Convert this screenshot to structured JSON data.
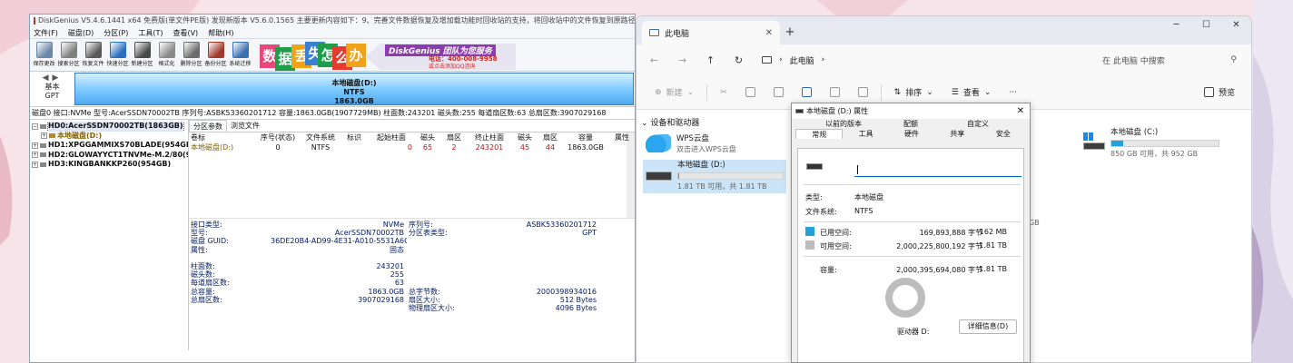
{
  "diskgenius": {
    "title": "DiskGenius V5.4.6.1441 x64 免费版(单文件PE版)  发现新版本 V5.6.0.1565  主要更新内容如下：9、完善文件数据恢复及增加载功能时回收站的支持，将回收站中的文件恢复到原路径。",
    "menu": [
      "文件(F)",
      "磁盘(D)",
      "分区(P)",
      "工具(T)",
      "查看(V)",
      "帮助(H)"
    ],
    "toolbar": [
      {
        "label": "保存更改",
        "icon": "save-icon",
        "color": "#6a86a8"
      },
      {
        "label": "搜索分区",
        "icon": "search-icon",
        "color": "#7f7f7f"
      },
      {
        "label": "恢复文件",
        "icon": "recover-icon",
        "color": "#5a5a5a"
      },
      {
        "label": "快速分区",
        "icon": "quick-partition-icon",
        "color": "#2a6fbf"
      },
      {
        "label": "新建分区",
        "icon": "new-partition-icon",
        "color": "#4a4a4a"
      },
      {
        "label": "格式化",
        "icon": "format-icon",
        "color": "#8a8a8a"
      },
      {
        "label": "删除分区",
        "icon": "delete-icon",
        "color": "#6b6b6b"
      },
      {
        "label": "备份分区",
        "icon": "backup-icon",
        "color": "#a03a2a"
      },
      {
        "label": "系统迁移",
        "icon": "migrate-icon",
        "color": "#3a6fb0"
      }
    ],
    "ad": {
      "tiles": [
        {
          "ch": "数",
          "color": "#e8487b"
        },
        {
          "ch": "据",
          "color": "#1f9e4a"
        },
        {
          "ch": "丢",
          "color": "#f0a21a"
        },
        {
          "ch": "失",
          "color": "#3a7fd0"
        },
        {
          "ch": "怎",
          "color": "#1f9e4a"
        },
        {
          "ch": "么",
          "color": "#e53a2f"
        },
        {
          "ch": "办",
          "color": "#f0a21a"
        }
      ],
      "slogan": "DiskGenius 团队为您服务",
      "phone": "电话：400-008-9958",
      "qq": "或点击添加QQ咨询"
    },
    "nav": {
      "arrows": "◀▶",
      "label1": "基本",
      "label2": "GPT"
    },
    "partition_bar": {
      "name": "本地磁盘(D:)",
      "fs": "NTFS",
      "size": "1863.0GB"
    },
    "disk_info": "磁盘0 接口:NVMe  型号:AcerSSDN70002TB  序列号:ASBK53360201712  容量:1863.0GB(1907729MB)  柱面数:243201  磁头数:255  每道扇区数:63  总扇区数:3907029168",
    "tree": [
      {
        "label": "HD0:AcerSSDN70002TB(1863GB)",
        "level": 0,
        "sign": "−",
        "selected": true
      },
      {
        "label": "本地磁盘(D:)",
        "level": 1,
        "sign": "+",
        "partition": true
      },
      {
        "label": "HD1:XPGGAMMIXS70BLADE(954GB)",
        "level": 0,
        "sign": "+"
      },
      {
        "label": "HD2:GLOWAYYCT1TNVMe-M.2/80(954",
        "level": 0,
        "sign": "+"
      },
      {
        "label": "HD3:KINGBANKKP260(954GB)",
        "level": 0,
        "sign": "+"
      }
    ],
    "tabs": [
      "分区参数",
      "浏览文件"
    ],
    "table": {
      "headers": [
        "卷标",
        "序号(状态)",
        "文件系统",
        "标识",
        "起始柱面",
        "磁头",
        "扇区",
        "终止柱面",
        "磁头",
        "扇区",
        "容量",
        "属性"
      ],
      "rows": [
        [
          "本地磁盘(D:)",
          "0",
          "NTFS",
          "",
          "0",
          "65",
          "2",
          "243201",
          "45",
          "44",
          "1863.0GB",
          ""
        ]
      ]
    },
    "details": [
      [
        "接口类型:",
        "NVMe",
        "序列号:",
        "ASBK53360201712"
      ],
      [
        "型号:",
        "AcerSSDN70002TB",
        "分区表类型:",
        "GPT"
      ],
      [
        "磁盘 GUID:",
        "36DE20B4-AD99-4E31-A010-5531A6C96CCA",
        "",
        ""
      ],
      [
        "属性:",
        "固态",
        "",
        ""
      ],
      [
        "",
        "",
        "",
        ""
      ],
      [
        "柱面数:",
        "243201",
        "",
        ""
      ],
      [
        "磁头数:",
        "255",
        "",
        ""
      ],
      [
        "每道扇区数:",
        "63",
        "",
        ""
      ],
      [
        "总容量:",
        "1863.0GB",
        "总字节数:",
        "2000398934016"
      ],
      [
        "总扇区数:",
        "3907029168",
        "扇区大小:",
        "512 Bytes"
      ],
      [
        "",
        "",
        "物理扇区大小:",
        "4096 Bytes"
      ]
    ]
  },
  "explorer": {
    "tab_title": "此电脑",
    "tab_close": "✕",
    "new_tab": "+",
    "window_controls": [
      "─",
      "☐",
      "✕"
    ],
    "nav": [
      "←",
      "→",
      "↑",
      "↻"
    ],
    "path": "此电脑",
    "path_sep": "›",
    "search_placeholder": "在 此电脑 中搜索",
    "cmd": {
      "new": "新建",
      "sort": "排序",
      "view": "查看",
      "more": "···",
      "preview": "预览"
    },
    "section": "设备和驱动器",
    "drives": {
      "wps": {
        "name": "WPS云盘",
        "sub": "双击进入WPS云盘"
      },
      "d": {
        "name": "本地磁盘 (D:)",
        "sub": "1.81 TB 可用，共 1.81 TB",
        "used": 0.0001
      },
      "c": {
        "name": "本地磁盘 (C:)",
        "sub": "850 GB 可用，共 952 GB",
        "used": 0.107
      },
      "clipped_sub": "GB"
    }
  },
  "properties": {
    "title": "本地磁盘 (D:) 属性",
    "close": "✕",
    "tabs_top": [
      "以前的版本",
      "配额",
      "自定义"
    ],
    "tabs_bottom": [
      "常规",
      "工具",
      "硬件",
      "共享",
      "安全"
    ],
    "type_label": "类型:",
    "type_value": "本地磁盘",
    "fs_label": "文件系统:",
    "fs_value": "NTFS",
    "used_label": "已用空间:",
    "used_bytes": "169,893,888 字节",
    "used_size": "162 MB",
    "free_label": "可用空间:",
    "free_bytes": "2,000,225,800,192 字节",
    "free_size": "1.81 TB",
    "cap_label": "容量:",
    "cap_bytes": "2,000,395,694,080 字节",
    "cap_size": "1.81 TB",
    "drive_label": "驱动器 D:",
    "details_button": "详细信息(D)",
    "used_color": "#26a0da",
    "free_color": "#bdbdbd"
  }
}
